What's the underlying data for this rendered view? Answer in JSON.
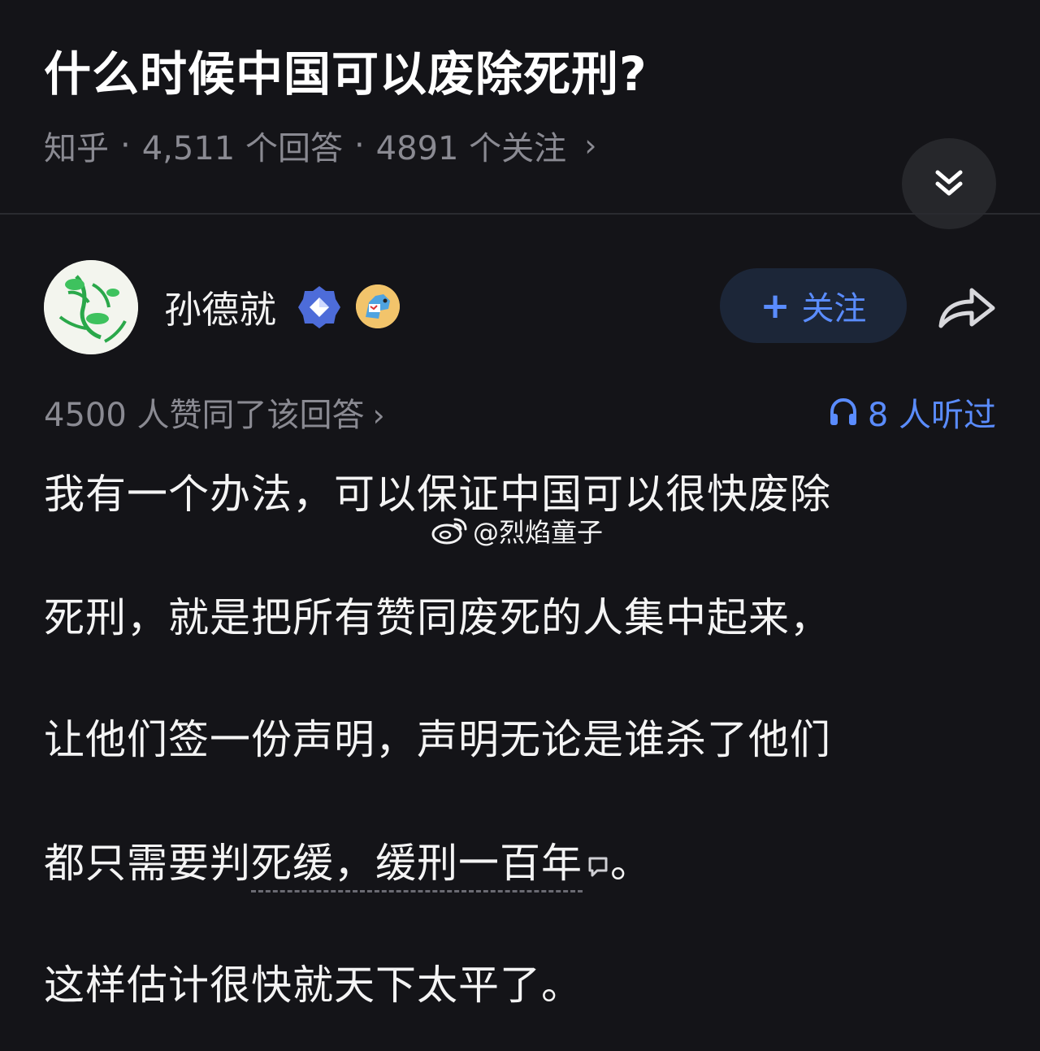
{
  "question": {
    "title": "什么时候中国可以废除死刑?",
    "source": "知乎",
    "answers": "4,511 个回答",
    "followers": "4891 个关注",
    "separator": "·"
  },
  "author": {
    "name": "孙德就",
    "follow_label": "关注",
    "follow_plus": "+"
  },
  "stats": {
    "upvotes": "4500 人赞同了该回答",
    "listen": "8 人听过"
  },
  "content": {
    "line1": "我有一个办法，可以保证中国可以很快废除",
    "line2": "死刑，就是把所有赞同废死的人集中起来，",
    "line3": "让他们签一份声明，声明无论是谁杀了他们",
    "line4_prefix": "都只需要判",
    "line4_underlined": "死缓，缓刑一百年",
    "line4_suffix": "。",
    "line5": "这样估计很快就天下太平了。"
  },
  "watermark": {
    "text": "@烈焰童子"
  },
  "icons": {
    "collapse": "double-chevron-down-icon",
    "share": "share-arrow-icon",
    "listen": "headphones-icon",
    "verified": "diamond-badge-icon",
    "medal": "horse-badge-icon",
    "weibo": "weibo-logo-icon",
    "comment": "comment-bubble-icon"
  },
  "colors": {
    "background": "#141418",
    "accent": "#5a8cff",
    "muted": "#8a8a92"
  }
}
